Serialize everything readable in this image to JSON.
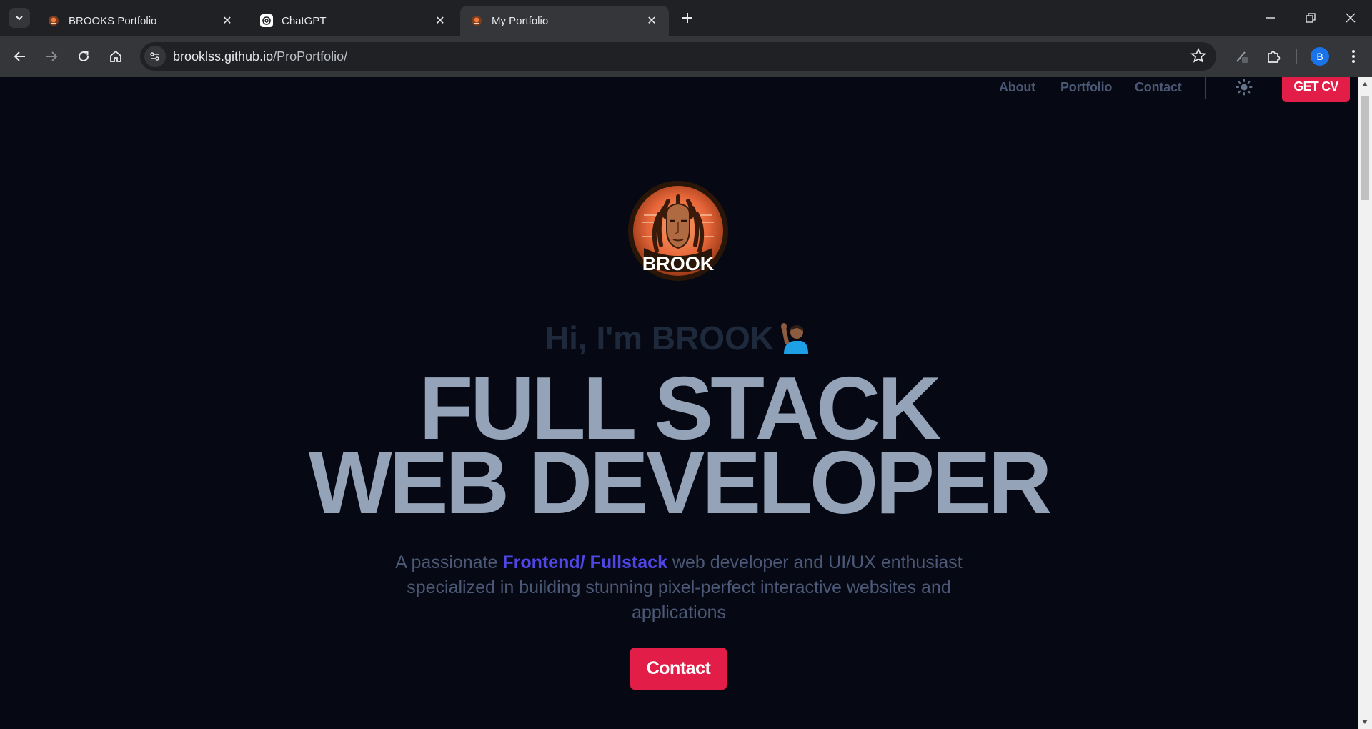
{
  "browser": {
    "tabs": [
      {
        "title": "BROOKS Portfolio",
        "active": false
      },
      {
        "title": "ChatGPT",
        "active": false
      },
      {
        "title": "My Portfolio",
        "active": true
      }
    ],
    "url_host": "brooklss.github.io",
    "url_path": "/ProPortfolio/",
    "profile_initial": "B"
  },
  "nav": {
    "links": [
      "About",
      "Portfolio",
      "Contact"
    ],
    "cv_button": "GET CV",
    "theme_icon": "sun-icon"
  },
  "hero": {
    "logo_text": "BROOK",
    "greeting": "Hi, I'm BROOK",
    "greeting_emoji": "person-raising-hand-icon",
    "headline_line1": "FULL STACK",
    "headline_line2": "WEB DEVELOPER",
    "tagline_pre": "A passionate ",
    "tagline_highlight": "Frontend/ Fullstack",
    "tagline_post": " web developer and UI/UX enthusiast specialized in building stunning pixel-perfect interactive websites and applications",
    "contact_button": "Contact"
  },
  "colors": {
    "page_bg": "#060913",
    "accent": "#e11d48",
    "highlight": "#4f46e5",
    "headline": "#94a3b8"
  }
}
